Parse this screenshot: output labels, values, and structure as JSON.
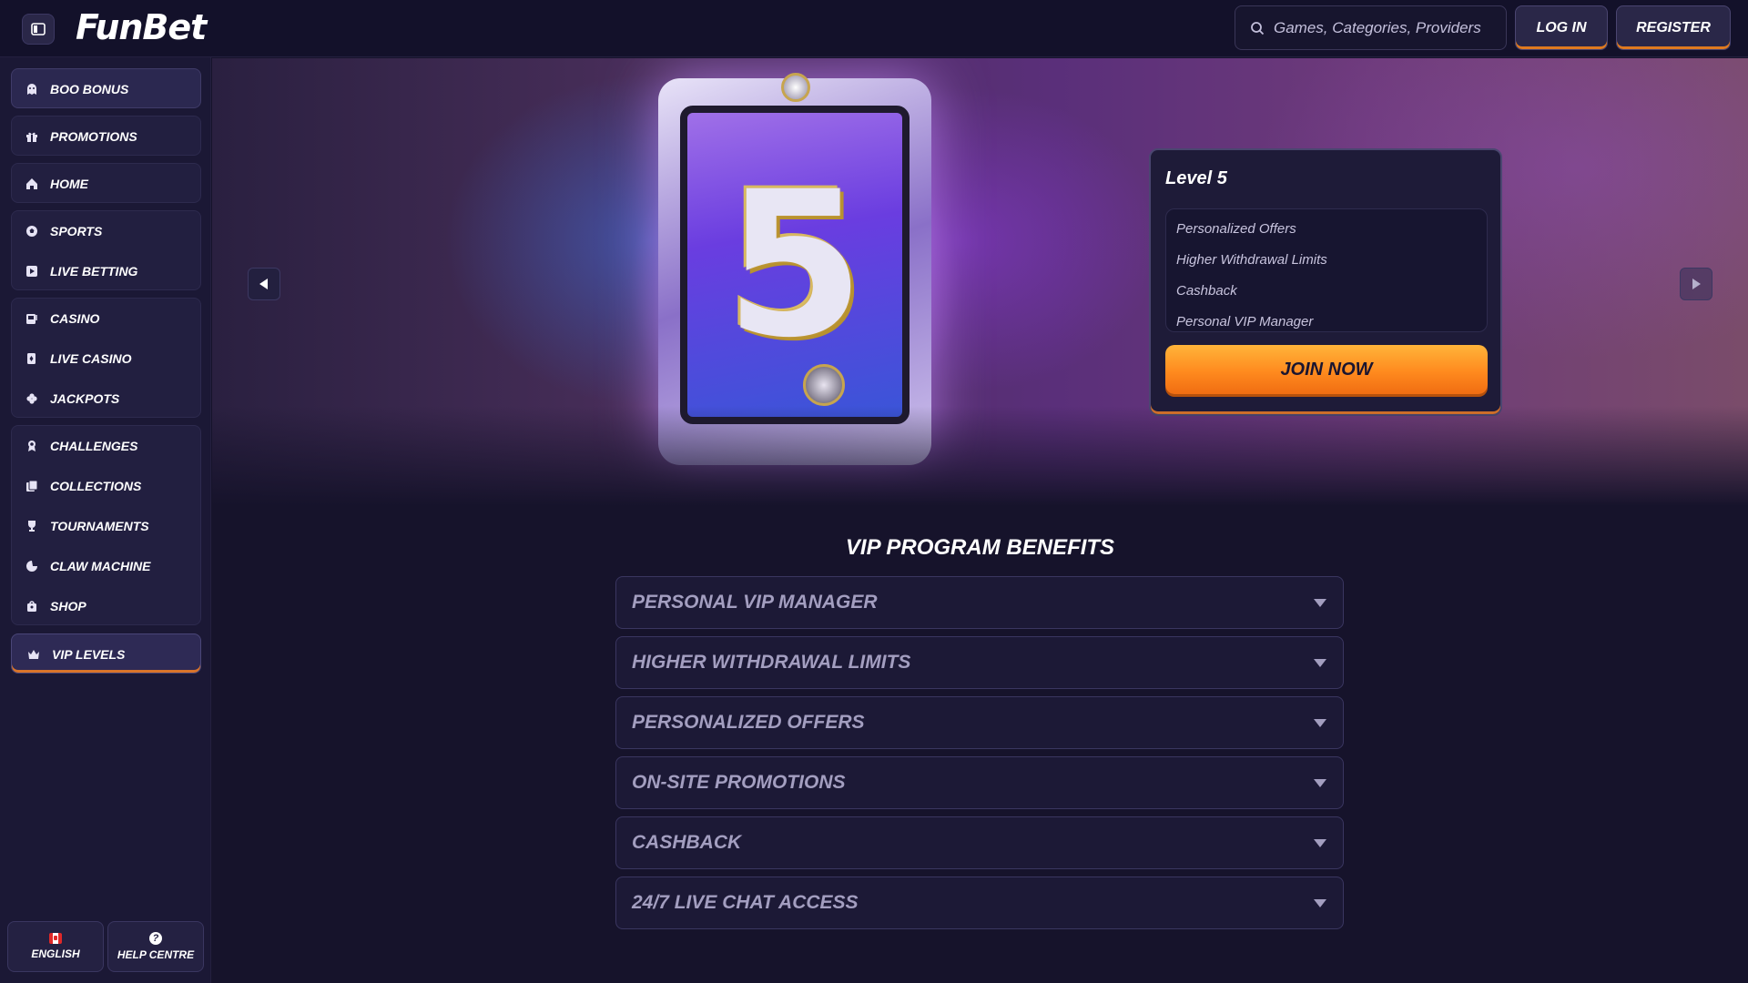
{
  "header": {
    "logo": "FunBet",
    "search_placeholder": "Games, Categories, Providers",
    "login_label": "LOG IN",
    "register_label": "REGISTER"
  },
  "sidebar": {
    "boo_bonus": "BOO BONUS",
    "group1": [
      "PROMOTIONS"
    ],
    "group2": [
      "HOME"
    ],
    "group3": [
      "SPORTS",
      "LIVE BETTING"
    ],
    "group4": [
      "CASINO",
      "LIVE CASINO",
      "JACKPOTS"
    ],
    "group5": [
      "CHALLENGES",
      "COLLECTIONS",
      "TOURNAMENTS",
      "CLAW MACHINE",
      "SHOP"
    ],
    "vip_levels": "VIP LEVELS",
    "language": "ENGLISH",
    "help": "HELP CENTRE"
  },
  "hero": {
    "card_number": "5",
    "level_title": "Level 5",
    "level_benefits": [
      "Personalized Offers",
      "Higher Withdrawal Limits",
      "Cashback",
      "Personal VIP Manager"
    ],
    "join_label": "JOIN NOW"
  },
  "benefits": {
    "title": "VIP PROGRAM BENEFITS",
    "items": [
      "PERSONAL VIP MANAGER",
      "HIGHER WITHDRAWAL LIMITS",
      "PERSONALIZED OFFERS",
      "ON-SITE PROMOTIONS",
      "CASHBACK",
      "24/7 LIVE CHAT ACCESS"
    ]
  },
  "colors": {
    "accent_orange": "#ff8a1e",
    "background": "#16132b",
    "sidebar": "#1b1835"
  }
}
